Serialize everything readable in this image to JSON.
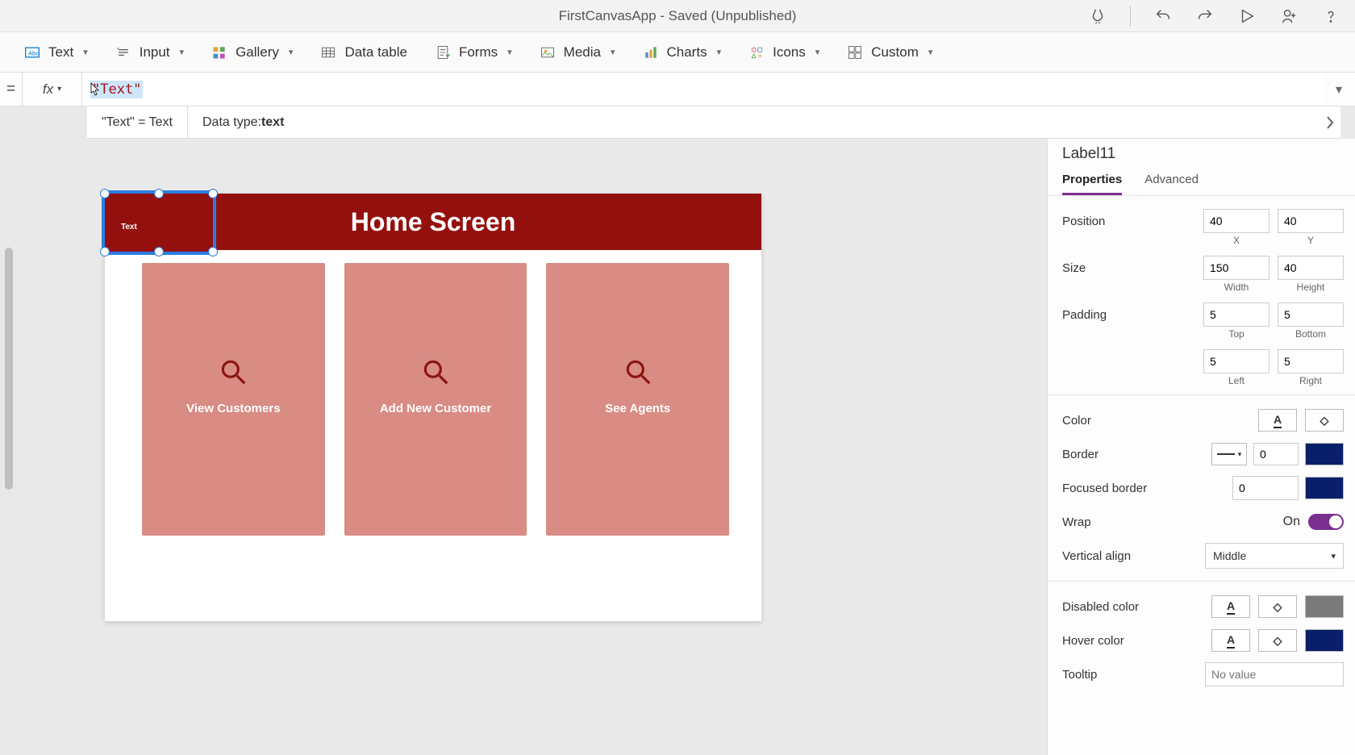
{
  "titlebar": {
    "title": "FirstCanvasApp - Saved (Unpublished)"
  },
  "ribbon": {
    "text": "Text",
    "input": "Input",
    "gallery": "Gallery",
    "data_table": "Data table",
    "forms": "Forms",
    "media": "Media",
    "charts": "Charts",
    "icons": "Icons",
    "custom": "Custom"
  },
  "formula": {
    "eq": "=",
    "fx": "fx",
    "value": "\"Text\"",
    "intelli_lhs": "\"Text\"  =  Text",
    "intelli_dt_label": "Data type: ",
    "intelli_dt_value": "text"
  },
  "canvas": {
    "header_title": "Home Screen",
    "selected_label_text": "Text",
    "cards": [
      {
        "label": "View Customers"
      },
      {
        "label": "Add New Customer"
      },
      {
        "label": "See Agents"
      }
    ]
  },
  "props": {
    "control_name": "Label11",
    "tab_properties": "Properties",
    "tab_advanced": "Advanced",
    "position_label": "Position",
    "position_x": "40",
    "position_y": "40",
    "x_label": "X",
    "y_label": "Y",
    "size_label": "Size",
    "size_w": "150",
    "size_h": "40",
    "w_label": "Width",
    "h_label": "Height",
    "padding_label": "Padding",
    "pad_top": "5",
    "pad_bottom": "5",
    "pad_top_label": "Top",
    "pad_bottom_label": "Bottom",
    "pad_left": "5",
    "pad_right": "5",
    "pad_left_label": "Left",
    "pad_right_label": "Right",
    "color_label": "Color",
    "border_label": "Border",
    "border_width": "0",
    "focused_border_label": "Focused border",
    "focused_border_width": "0",
    "wrap_label": "Wrap",
    "wrap_on": "On",
    "valign_label": "Vertical align",
    "valign_value": "Middle",
    "disabled_color_label": "Disabled color",
    "hover_color_label": "Hover color",
    "tooltip_label": "Tooltip",
    "tooltip_placeholder": "No value",
    "glyph_A": "A",
    "fill_glyph": "◇"
  }
}
